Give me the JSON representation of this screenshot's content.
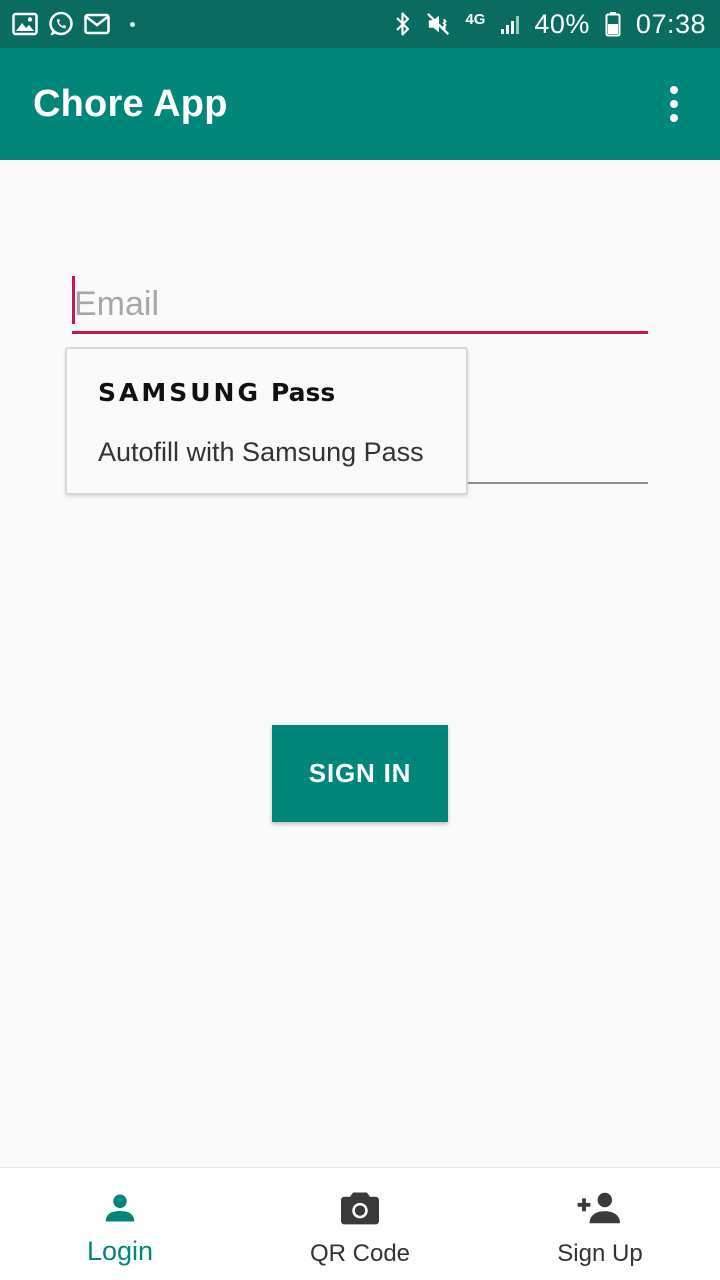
{
  "status_bar": {
    "left_icons": [
      "gallery-icon",
      "whatsapp-icon",
      "mail-icon",
      "dot-icon"
    ],
    "right_icons": [
      "bluetooth-icon",
      "mute-vibrate-icon",
      "4g-icon",
      "signal-icon",
      "battery-icon"
    ],
    "network_label": "4G",
    "battery_percent": "40%",
    "time": "07:38"
  },
  "app_bar": {
    "title": "Chore App",
    "menu_icon": "more-vertical-icon"
  },
  "login_form": {
    "email_placeholder": "Email",
    "email_value": "",
    "password_value": ""
  },
  "autofill": {
    "brand_samsung": "SAMSUNG",
    "brand_pass": "Pass",
    "action_label": "Autofill with Samsung Pass"
  },
  "signin": {
    "label": "SIGN IN"
  },
  "bottom_nav": {
    "items": [
      {
        "label": "Login",
        "icon": "person-icon",
        "active": true
      },
      {
        "label": "QR Code",
        "icon": "camera-icon",
        "active": false
      },
      {
        "label": "Sign Up",
        "icon": "person-add-icon",
        "active": false
      }
    ]
  },
  "colors": {
    "status_bar": "#0a6b60",
    "primary": "#00877a",
    "accent": "#c2185b",
    "background": "#fafafa"
  }
}
